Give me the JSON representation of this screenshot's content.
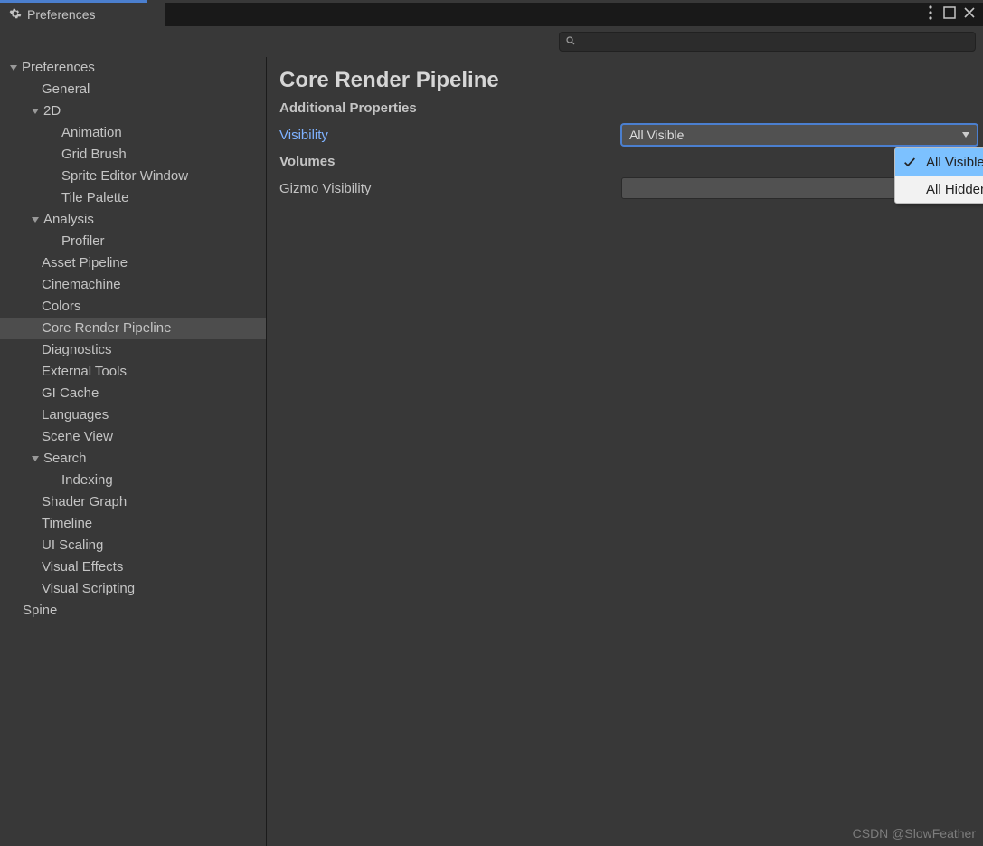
{
  "tab_title": "Preferences",
  "sidebar": {
    "items": [
      {
        "label": "Preferences",
        "indent": 8,
        "foldable": true
      },
      {
        "label": "General",
        "indent": 46,
        "foldable": false
      },
      {
        "label": "2D",
        "indent": 32,
        "foldable": true
      },
      {
        "label": "Animation",
        "indent": 68,
        "foldable": false
      },
      {
        "label": "Grid Brush",
        "indent": 68,
        "foldable": false
      },
      {
        "label": "Sprite Editor Window",
        "indent": 68,
        "foldable": false
      },
      {
        "label": "Tile Palette",
        "indent": 68,
        "foldable": false
      },
      {
        "label": "Analysis",
        "indent": 32,
        "foldable": true
      },
      {
        "label": "Profiler",
        "indent": 68,
        "foldable": false
      },
      {
        "label": "Asset Pipeline",
        "indent": 46,
        "foldable": false
      },
      {
        "label": "Cinemachine",
        "indent": 46,
        "foldable": false
      },
      {
        "label": "Colors",
        "indent": 46,
        "foldable": false
      },
      {
        "label": "Core Render Pipeline",
        "indent": 46,
        "foldable": false,
        "selected": true
      },
      {
        "label": "Diagnostics",
        "indent": 46,
        "foldable": false
      },
      {
        "label": "External Tools",
        "indent": 46,
        "foldable": false
      },
      {
        "label": "GI Cache",
        "indent": 46,
        "foldable": false
      },
      {
        "label": "Languages",
        "indent": 46,
        "foldable": false
      },
      {
        "label": "Scene View",
        "indent": 46,
        "foldable": false
      },
      {
        "label": "Search",
        "indent": 32,
        "foldable": true
      },
      {
        "label": "Indexing",
        "indent": 68,
        "foldable": false
      },
      {
        "label": "Shader Graph",
        "indent": 46,
        "foldable": false
      },
      {
        "label": "Timeline",
        "indent": 46,
        "foldable": false
      },
      {
        "label": "UI Scaling",
        "indent": 46,
        "foldable": false
      },
      {
        "label": "Visual Effects",
        "indent": 46,
        "foldable": false
      },
      {
        "label": "Visual Scripting",
        "indent": 46,
        "foldable": false
      },
      {
        "label": "Spine",
        "indent": 25,
        "foldable": false
      }
    ]
  },
  "panel": {
    "title": "Core Render Pipeline",
    "section_additional": "Additional Properties",
    "visibility_label": "Visibility",
    "visibility_value": "All Visible",
    "section_volumes": "Volumes",
    "gizmo_label": "Gizmo Visibility",
    "gizmo_value": "",
    "dropdown_options": [
      "All Visible",
      "All Hidden"
    ]
  },
  "watermark": "CSDN @SlowFeather"
}
